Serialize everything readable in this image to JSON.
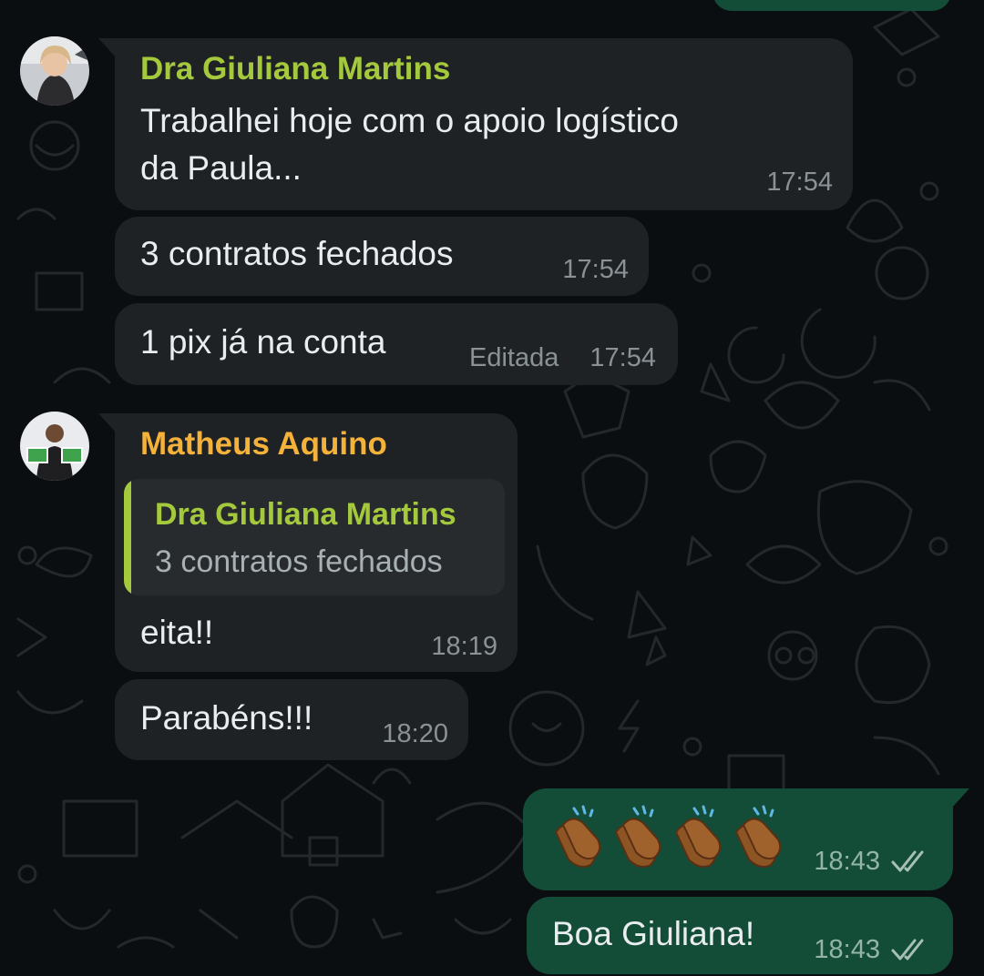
{
  "colors": {
    "background": "#0b0e10",
    "incoming_bubble": "#1f2225",
    "outgoing_bubble": "#144d37",
    "sender_giuliana": "#a5c93c",
    "sender_matheus": "#f5b23b",
    "timestamp": "#8a9295",
    "ticks": "#a7c0b5"
  },
  "messages": [
    {
      "sender": "Dra Giuliana Martins",
      "text_line1": "Trabalhei hoje com o apoio logístico",
      "text_line2": "da Paula...",
      "time": "17:54"
    },
    {
      "text": "3 contratos fechados",
      "time": "17:54"
    },
    {
      "text": "1 pix já na conta",
      "edited_label": "Editada",
      "time": "17:54"
    },
    {
      "sender": "Matheus Aquino",
      "quote": {
        "sender": "Dra Giuliana Martins",
        "text": "3 contratos fechados"
      },
      "text": "eita!!",
      "time": "18:19"
    },
    {
      "text": "Parabéns!!!",
      "time": "18:20"
    },
    {
      "emoji": "👏🏾👏🏾👏🏾👏🏾",
      "emoji_count": 4,
      "time": "18:43",
      "status": "read"
    },
    {
      "text": "Boa Giuliana!",
      "time": "18:43",
      "status": "read"
    }
  ]
}
